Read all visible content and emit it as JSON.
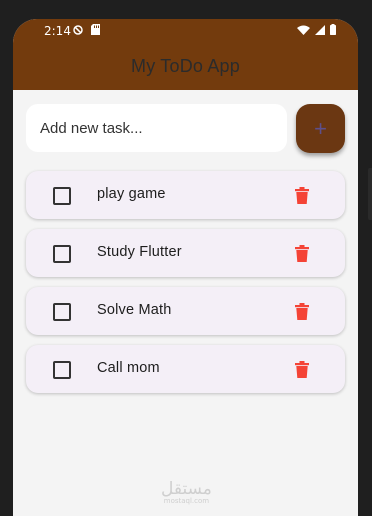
{
  "status_bar": {
    "time": "2:14",
    "icons_left": [
      "do-not-disturb-icon",
      "sd-card-icon"
    ],
    "icons_right": [
      "wifi-icon",
      "signal-icon",
      "battery-icon"
    ]
  },
  "app_bar": {
    "title": "My ToDo App"
  },
  "new_task": {
    "placeholder": "Add new task...",
    "value": "",
    "add_button_label": "+"
  },
  "tasks": [
    {
      "label": "play game",
      "checked": false
    },
    {
      "label": "Study Flutter",
      "checked": false
    },
    {
      "label": "Solve Math",
      "checked": false
    },
    {
      "label": "Call mom",
      "checked": false
    }
  ],
  "watermark": {
    "text": "مستقل",
    "subtext": "mostaql.com"
  },
  "colors": {
    "app_bar": "#733b0d",
    "add_button": "#6b3712",
    "card_background": "#f4eff7",
    "delete_icon": "#f44336",
    "page_background": "#f4f4f4"
  }
}
